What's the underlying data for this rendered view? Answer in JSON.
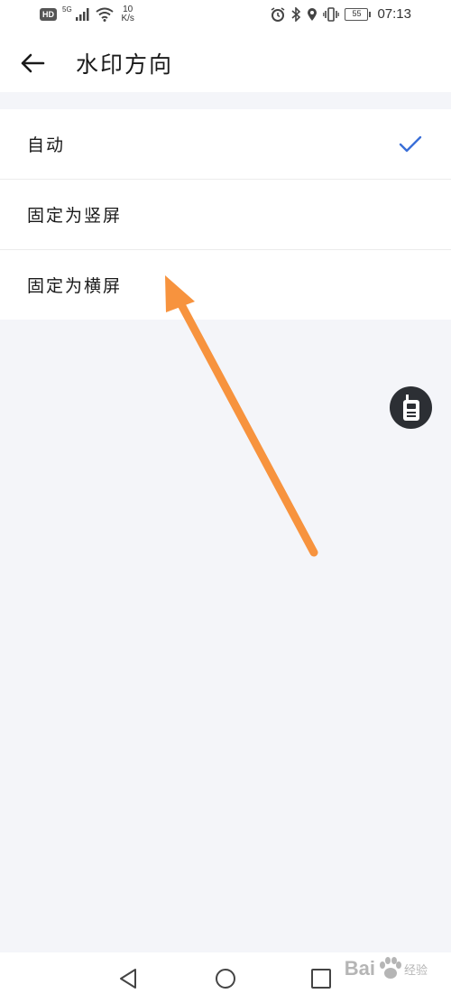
{
  "status_bar": {
    "hd": "HD",
    "network": "5G",
    "speed_value": "10",
    "speed_unit": "K/s",
    "battery": "55",
    "time": "07:13"
  },
  "header": {
    "title": "水印方向"
  },
  "options": [
    {
      "label": "自动",
      "selected": true
    },
    {
      "label": "固定为竖屏",
      "selected": false
    },
    {
      "label": "固定为横屏",
      "selected": false
    }
  ],
  "colors": {
    "accent": "#3a6fd8",
    "annotation": "#f7933e",
    "float_button": "#2c2f34",
    "background": "#f4f5f9"
  },
  "icons": {
    "back": "arrow-left-icon",
    "check": "check-icon",
    "float": "walkie-talkie-icon"
  },
  "watermark": {
    "brand": "Bai",
    "sub": "经验"
  }
}
